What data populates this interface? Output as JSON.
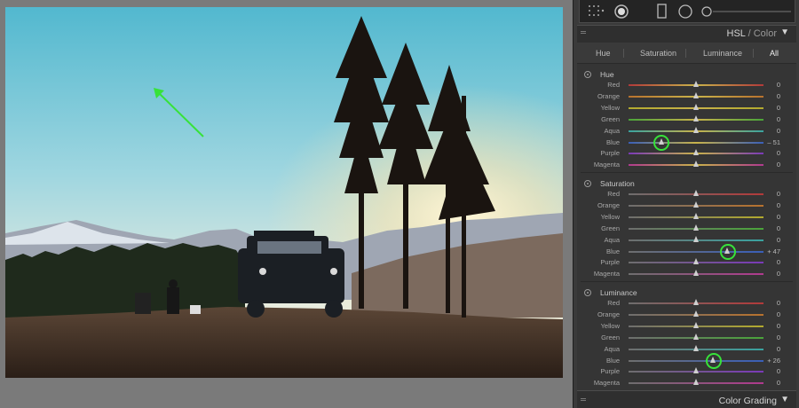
{
  "panel": {
    "title_main": "HSL",
    "title_separator": "/",
    "title_secondary": "Color",
    "collapse_icon": "triangle-down-icon",
    "tabs": [
      "Hue",
      "Saturation",
      "Luminance",
      "All"
    ],
    "active_tab": "All",
    "footer_title": "Color Grading"
  },
  "toolbar": {
    "tools": [
      "grid-dots-icon",
      "radial-dot-icon",
      "rectangle-icon",
      "circle-icon",
      "range-slider-icon"
    ]
  },
  "sections": [
    {
      "title": "Hue",
      "rows": [
        {
          "label": "Red",
          "value": "0",
          "level": 0
        },
        {
          "label": "Orange",
          "value": "0",
          "level": 0
        },
        {
          "label": "Yellow",
          "value": "0",
          "level": 0
        },
        {
          "label": "Green",
          "value": "0",
          "level": 0
        },
        {
          "label": "Aqua",
          "value": "0",
          "level": 0
        },
        {
          "label": "Blue",
          "value": "– 51",
          "level": -51,
          "highlighted": true
        },
        {
          "label": "Purple",
          "value": "0",
          "level": 0
        },
        {
          "label": "Magenta",
          "value": "0",
          "level": 0
        }
      ]
    },
    {
      "title": "Saturation",
      "rows": [
        {
          "label": "Red",
          "value": "0",
          "level": 0
        },
        {
          "label": "Orange",
          "value": "0",
          "level": 0
        },
        {
          "label": "Yellow",
          "value": "0",
          "level": 0
        },
        {
          "label": "Green",
          "value": "0",
          "level": 0
        },
        {
          "label": "Aqua",
          "value": "0",
          "level": 0
        },
        {
          "label": "Blue",
          "value": "+ 47",
          "level": 47,
          "highlighted": true
        },
        {
          "label": "Purple",
          "value": "0",
          "level": 0
        },
        {
          "label": "Magenta",
          "value": "0",
          "level": 0
        }
      ]
    },
    {
      "title": "Luminance",
      "rows": [
        {
          "label": "Red",
          "value": "0",
          "level": 0
        },
        {
          "label": "Orange",
          "value": "0",
          "level": 0
        },
        {
          "label": "Yellow",
          "value": "0",
          "level": 0
        },
        {
          "label": "Green",
          "value": "0",
          "level": 0
        },
        {
          "label": "Aqua",
          "value": "0",
          "level": 0
        },
        {
          "label": "Blue",
          "value": "+ 26",
          "level": 26,
          "highlighted": true
        },
        {
          "label": "Purple",
          "value": "0",
          "level": 0
        },
        {
          "label": "Magenta",
          "value": "0",
          "level": 0
        }
      ]
    }
  ],
  "colors": {
    "highlight_ring": "#37e23a",
    "annotation_arrow": "#37e23a",
    "track_red": "#b23a3a",
    "track_orange": "#b8722e",
    "track_yellow": "#b3aa2e",
    "track_green": "#4aa43a",
    "track_aqua": "#3aa3a0",
    "track_blue": "#3a5fb8",
    "track_purple": "#7a3ab8",
    "track_magenta": "#b03a8e"
  }
}
